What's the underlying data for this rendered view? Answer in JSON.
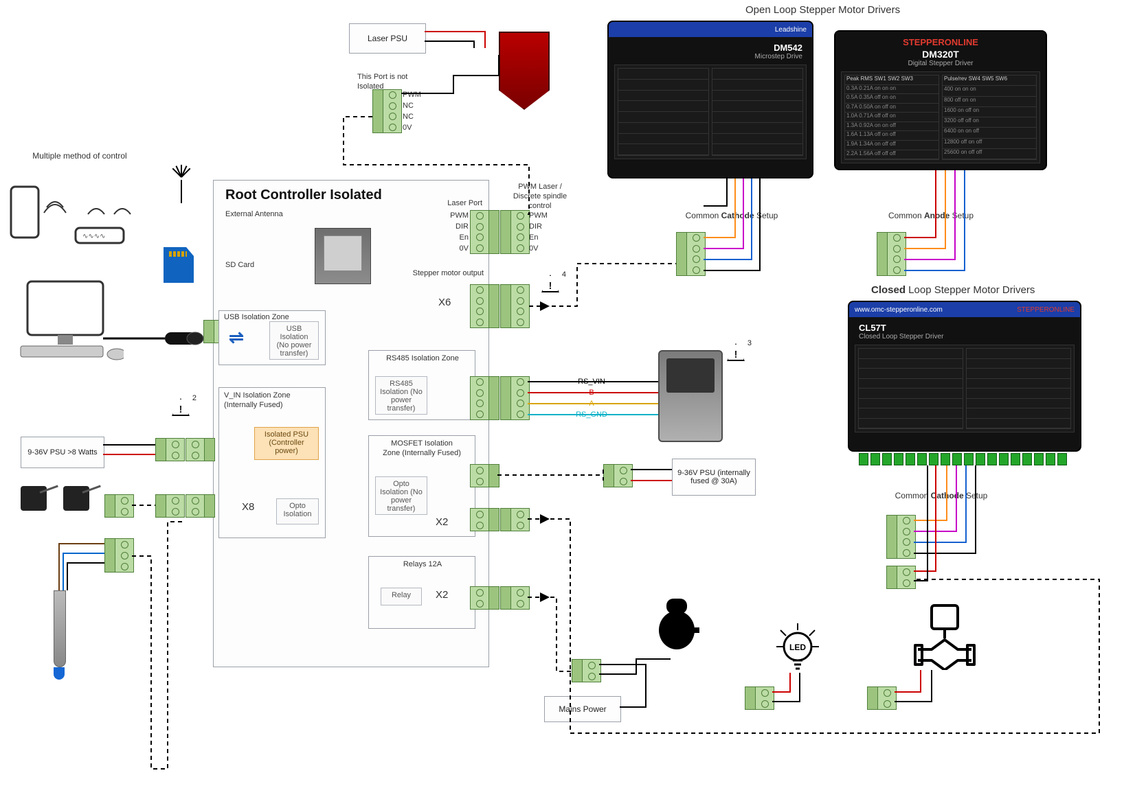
{
  "headings": {
    "open_drivers": "Open Loop Stepper Motor Drivers",
    "closed_drivers": "Closed Loop Stepper Motor Drivers",
    "root_controller": "Root Controller Isolated",
    "cathode_setup": "Common Cathode Setup",
    "anode_setup": "Common Anode Setup",
    "cathode_setup_2": "Common Cathode Setup",
    "multi_control": "Multiple method of control"
  },
  "laser": {
    "psu_label": "Laser PSU",
    "port_warning": "This Port is not Isolated",
    "pins": [
      "PWM",
      "NC",
      "NC",
      "0V"
    ],
    "port_side_label": "Laser Port",
    "ctrl_pins_left": [
      "PWM",
      "DIR",
      "En",
      "0V"
    ],
    "side_title": "PWM Laser / Discrete spindle control",
    "side_pins": [
      "PWM",
      "DIR",
      "En",
      "0V"
    ]
  },
  "controller": {
    "ext_antenna": "External Antenna",
    "sd_card": "SD Card",
    "zones": {
      "usb": {
        "title": "USB Isolation Zone",
        "box": "USB Isolation (No power transfer)"
      },
      "vin": {
        "title": "V_IN Isolation Zone (Internally Fused)",
        "iso_psu": "Isolated PSU (Controller power)",
        "opto": "Opto Isolation"
      },
      "rs485": {
        "title": "RS485 Isolation Zone",
        "box": "RS485 Isolation (No power transfer)"
      },
      "mosfet": {
        "title": "MOSFET Isolation Zone (Internally Fused)",
        "box": "Opto Isolation (No power transfer)"
      },
      "relays": {
        "title": "Relays 12A",
        "box": "Relay"
      }
    },
    "multipliers": {
      "inputs": "X8",
      "stepper": "X6",
      "mosfet": "X2",
      "relays": "X2"
    },
    "stepper_out": "Stepper motor output"
  },
  "power": {
    "ctrl_psu": "9-36V PSU >8 Watts",
    "mosfet_psu": "9-36V PSU (internally fused @ 30A)",
    "mains": "Mains Power"
  },
  "rs485": {
    "pins": [
      "RS_VIN",
      "B",
      "A",
      "RS_GND"
    ]
  },
  "drivers": {
    "dm542": {
      "brand": "Leadshine",
      "model": "DM542",
      "sub": "Microstep Drive"
    },
    "dm320t": {
      "brand": "STEPPERONLINE",
      "model": "DM320T",
      "sub": "Digital Stepper Driver",
      "pk_table_header": [
        "Peak",
        "RMS",
        "SW1",
        "SW2",
        "SW3"
      ],
      "pk_table": [
        [
          "0.3A",
          "0.21A",
          "on",
          "on",
          "on"
        ],
        [
          "0.5A",
          "0.35A",
          "off",
          "on",
          "on"
        ],
        [
          "0.7A",
          "0.50A",
          "on",
          "off",
          "on"
        ],
        [
          "1.0A",
          "0.71A",
          "off",
          "off",
          "on"
        ],
        [
          "1.3A",
          "0.92A",
          "on",
          "on",
          "off"
        ],
        [
          "1.6A",
          "1.13A",
          "off",
          "on",
          "off"
        ],
        [
          "1.9A",
          "1.34A",
          "on",
          "off",
          "off"
        ],
        [
          "2.2A",
          "1.56A",
          "off",
          "off",
          "off"
        ]
      ],
      "pulse_table_header": [
        "Pulse/rev",
        "SW4",
        "SW5",
        "SW6"
      ],
      "pulse_table": [
        [
          "400",
          "on",
          "on",
          "on"
        ],
        [
          "800",
          "off",
          "on",
          "on"
        ],
        [
          "1600",
          "on",
          "off",
          "on"
        ],
        [
          "3200",
          "off",
          "off",
          "on"
        ],
        [
          "6400",
          "on",
          "on",
          "off"
        ],
        [
          "12800",
          "off",
          "on",
          "off"
        ],
        [
          "25600",
          "on",
          "off",
          "off"
        ]
      ]
    },
    "cl57t": {
      "brand": "STEPPERONLINE",
      "model": "CL57T",
      "sub": "Closed Loop Stepper Driver",
      "url": "www.omc-stepperonline.com"
    }
  },
  "warnings": {
    "n2": "2",
    "n3": "3",
    "n4": "4"
  }
}
